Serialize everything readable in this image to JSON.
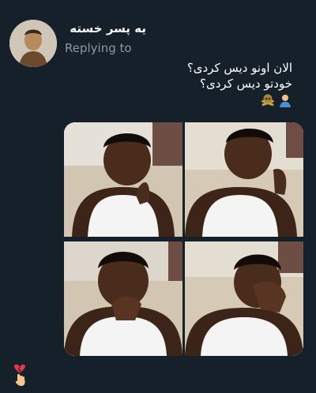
{
  "tweet": {
    "display_name": "یه پسر خسته",
    "replying_label": "Replying to",
    "text_lines": [
      "الان اونو دیس کردی؟",
      "خودتو دیس کردی؟"
    ],
    "emojis": [
      "pointing-man-icon",
      "skull-crossbones-icon"
    ]
  },
  "media": {
    "panels": [
      {
        "name": "thinking-boy-panel"
      },
      {
        "name": "looking-away-boy-panel"
      },
      {
        "name": "crying-boy-panel"
      },
      {
        "name": "facepalm-boy-panel"
      }
    ]
  },
  "footer": {
    "reaction_icon": "broken-heart-hand-icon"
  },
  "colors": {
    "background": "#15202b",
    "text": "#ffffff",
    "muted": "#8b98a5"
  }
}
